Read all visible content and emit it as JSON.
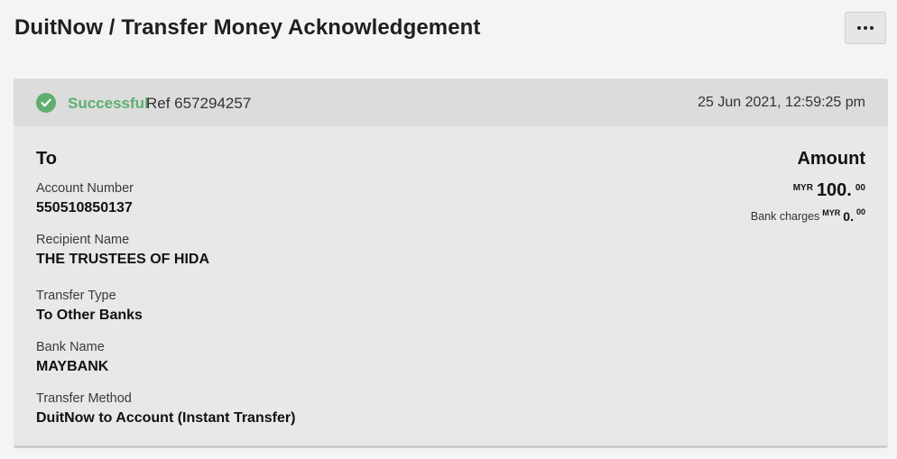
{
  "header": {
    "title": "DuitNow / Transfer Money Acknowledgement",
    "more_button": "more-options"
  },
  "status": {
    "icon": "check-circle-icon",
    "label": "Successful",
    "ref": "Ref 657294257",
    "datetime": "25 Jun 2021, 12:59:25 pm",
    "color": "#5fae70"
  },
  "recipient": {
    "heading": "To",
    "fields": [
      {
        "label": "Account Number",
        "value": "550510850137"
      },
      {
        "label": "Recipient Name",
        "value": "THE TRUSTEES OF HIDA"
      },
      {
        "label": "Transfer Type",
        "value": "To Other Banks"
      },
      {
        "label": "Bank Name",
        "value": "MAYBANK"
      },
      {
        "label": "Transfer Method",
        "value": "DuitNow to Account (Instant Transfer)"
      }
    ]
  },
  "amount": {
    "heading": "Amount",
    "currency": "MYR",
    "whole": "100.",
    "cents": "00",
    "charges_label": "Bank charges",
    "charges_currency": "MYR",
    "charges_whole": "0.",
    "charges_cents": "00"
  }
}
